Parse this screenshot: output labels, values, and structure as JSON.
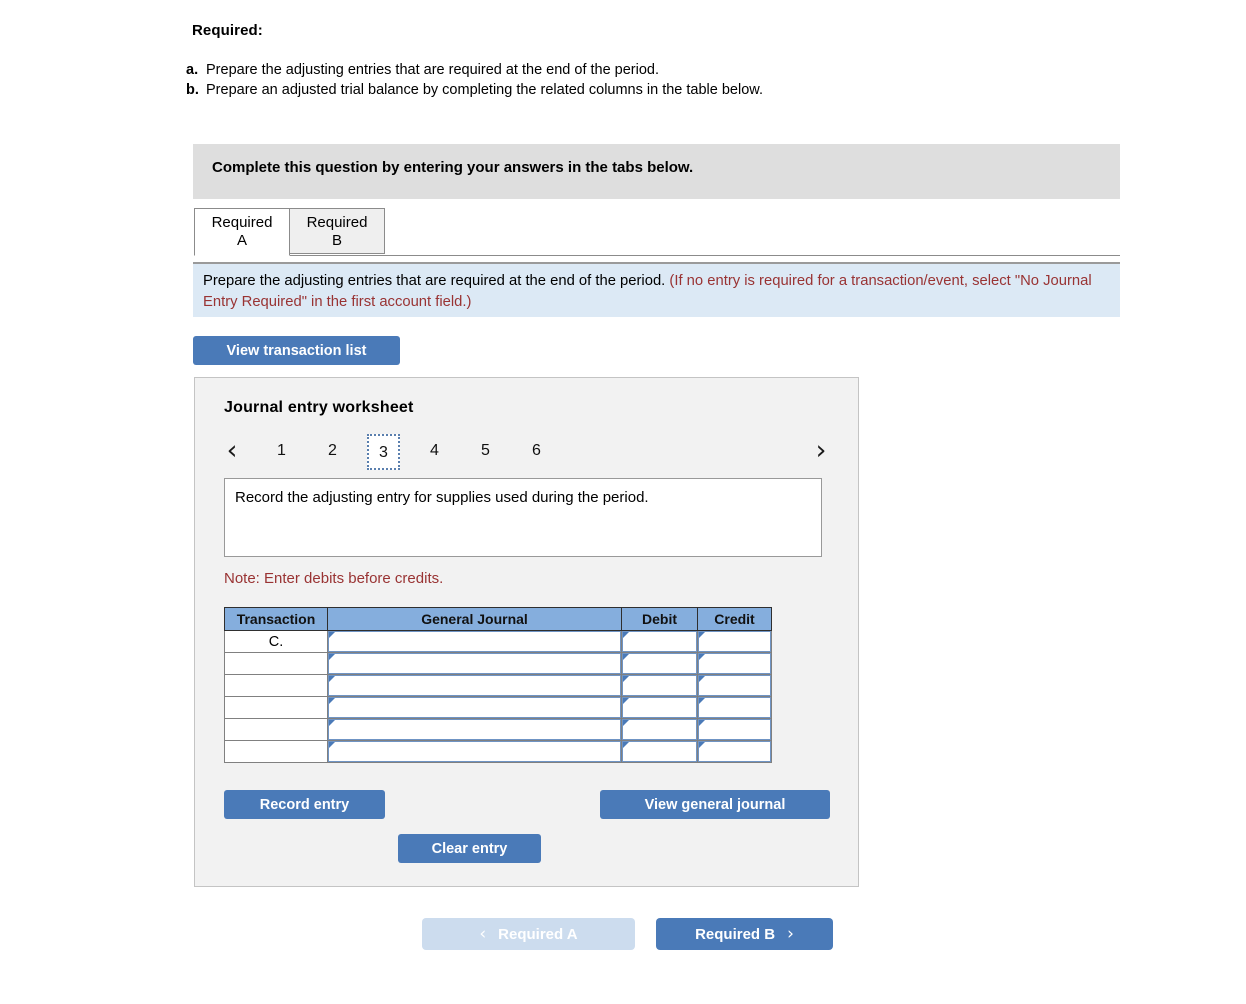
{
  "required": {
    "heading": "Required:",
    "items": [
      {
        "marker": "a.",
        "text": "Prepare the adjusting entries that are required at the end of the period."
      },
      {
        "marker": "b.",
        "text": "Prepare an adjusted trial balance by completing the related columns in the table below."
      }
    ]
  },
  "gray_banner": {
    "text": "Complete this question by entering your answers in the tabs below."
  },
  "tabs": [
    {
      "line1": "Required",
      "line2": "A",
      "active": true
    },
    {
      "line1": "Required",
      "line2": "B",
      "active": false
    }
  ],
  "instruction_banner": {
    "black_text": "Prepare the adjusting entries that are required at the end of the period.",
    "red_text": "(If no entry is required for a transaction/event, select \"No Journal Entry Required\" in the first account field.)"
  },
  "buttons": {
    "view_transaction_list": "View transaction list",
    "record_entry": "Record entry",
    "view_general_journal": "View general journal",
    "clear_entry": "Clear entry"
  },
  "worksheet": {
    "title": "Journal entry worksheet",
    "pager": {
      "prev_icon": "chevron-left",
      "next_icon": "chevron-right",
      "prev_glyph": "‹",
      "next_glyph": "›",
      "pages": [
        "1",
        "2",
        "3",
        "4",
        "5",
        "6"
      ],
      "current_page": "3"
    },
    "prompt": "Record the adjusting entry for supplies used during the period.",
    "note": "Note: Enter debits before credits.",
    "table": {
      "headers": [
        "Transaction",
        "General Journal",
        "Debit",
        "Credit"
      ],
      "rows": [
        {
          "transaction": "C.",
          "general_journal": "",
          "debit": "",
          "credit": ""
        },
        {
          "transaction": "",
          "general_journal": "",
          "debit": "",
          "credit": ""
        },
        {
          "transaction": "",
          "general_journal": "",
          "debit": "",
          "credit": ""
        },
        {
          "transaction": "",
          "general_journal": "",
          "debit": "",
          "credit": ""
        },
        {
          "transaction": "",
          "general_journal": "",
          "debit": "",
          "credit": ""
        },
        {
          "transaction": "",
          "general_journal": "",
          "debit": "",
          "credit": ""
        }
      ]
    }
  },
  "footer_nav": {
    "prev_label": "Required A",
    "next_label": "Required B",
    "prev_glyph": "‹",
    "next_glyph": "›",
    "prev_disabled": true
  },
  "colors": {
    "accent_blue": "#4a7ab8",
    "table_header_blue": "#85aedd",
    "banner_gray": "#dedede",
    "banner_light_blue": "#dce9f5",
    "red_text": "#993333",
    "panel_gray": "#f2f2f2",
    "disabled_blue": "#ccdcee"
  }
}
